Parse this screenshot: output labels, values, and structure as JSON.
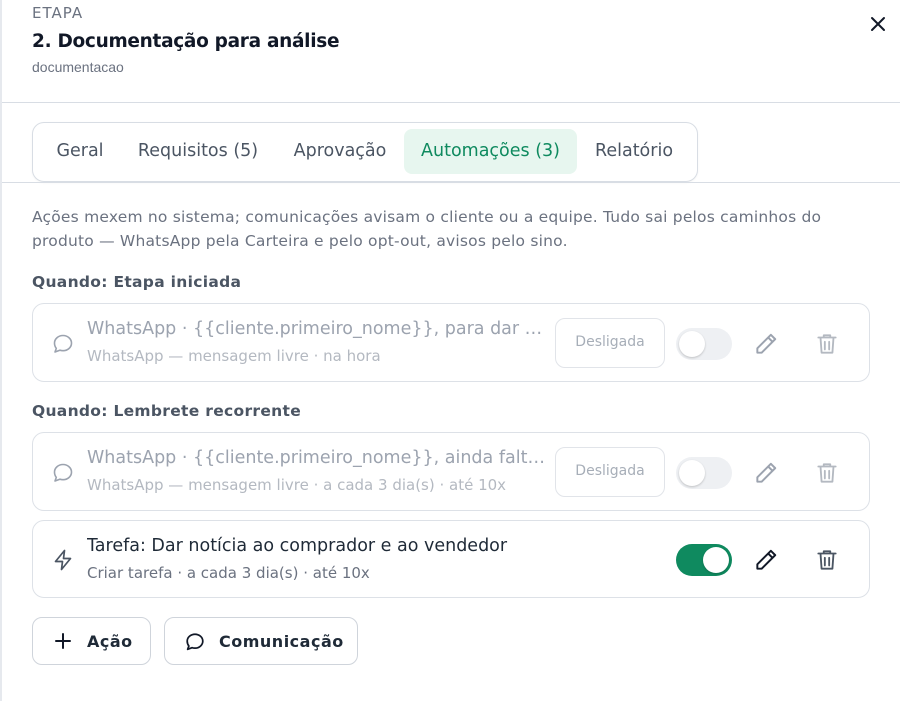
{
  "header": {
    "eyebrow": "ETAPA",
    "title": "2. Documentação para análise",
    "slug": "documentacao"
  },
  "tabs": [
    {
      "label": "Geral",
      "active": false
    },
    {
      "label": "Requisitos (5)",
      "active": false
    },
    {
      "label": "Aprovação",
      "active": false
    },
    {
      "label": "Automações (3)",
      "active": true
    },
    {
      "label": "Relatório",
      "active": false
    }
  ],
  "intro": "Ações mexem no sistema; comunicações avisam o cliente ou a equipe. Tudo sai pelos caminhos do produto — WhatsApp pela Carteira e pelo opt-out, avisos pelo sino.",
  "sections": [
    {
      "title": "Quando: Etapa iniciada",
      "items": [
        {
          "icon": "chat-bubble-icon",
          "line1": "WhatsApp · {{cliente.primeiro_nome}}, para dar ent…",
          "line2": "WhatsApp — mensagem livre · na hora",
          "badge": "Desligada",
          "enabled": false
        }
      ]
    },
    {
      "title": "Quando: Lembrete recorrente",
      "items": [
        {
          "icon": "chat-bubble-icon",
          "line1": "WhatsApp · {{cliente.primeiro_nome}}, ainda faltam…",
          "line2": "WhatsApp — mensagem livre · a cada 3 dia(s) · até 10x",
          "badge": "Desligada",
          "enabled": false
        },
        {
          "icon": "lightning-icon",
          "line1": "Tarefa: Dar notícia ao comprador e ao vendedor",
          "line2": "Criar tarefa · a cada 3 dia(s) · até 10x",
          "badge": "",
          "enabled": true
        }
      ]
    }
  ],
  "actions": {
    "add_action": "Ação",
    "add_communication": "Comunicação"
  },
  "colors": {
    "accent": "#0f8a5f",
    "accent_bg": "#e7f6ef",
    "muted_text": "#6b7280",
    "border": "#dde1e7"
  }
}
